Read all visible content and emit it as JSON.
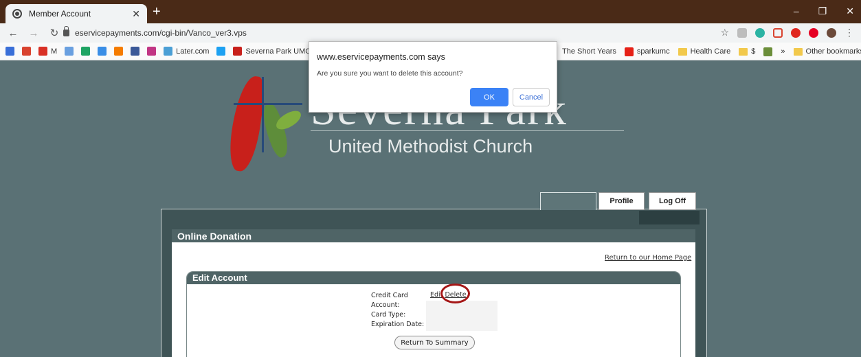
{
  "browser": {
    "tab_title": "Member Account",
    "new_tab": "+",
    "url": "eservicepayments.com/cgi-bin/Vanco_ver3.vps",
    "bookmarks_left": [
      {
        "label": "",
        "icon": "calendar-icon",
        "color": "#3a6fd8"
      },
      {
        "label": "",
        "icon": "todoist-icon",
        "color": "#d9432f"
      },
      {
        "label": "M",
        "icon": "gmail-icon",
        "color": "#d93025"
      },
      {
        "label": "",
        "icon": "ext-icon",
        "color": "#6aa0e0"
      },
      {
        "label": "",
        "icon": "drive-icon",
        "color": "#1fa463"
      },
      {
        "label": "",
        "icon": "diamond-icon",
        "color": "#3a8ee6"
      },
      {
        "label": "",
        "icon": "blogger-icon",
        "color": "#f57c00"
      },
      {
        "label": "",
        "icon": "facebook-icon",
        "color": "#3b5998"
      },
      {
        "label": "",
        "icon": "instagram-icon",
        "color": "#c13584"
      },
      {
        "label": "Later.com",
        "icon": "later-icon",
        "color": "#4b9fd5"
      },
      {
        "label": "",
        "icon": "twitter-icon",
        "color": "#1da1f2"
      },
      {
        "label": "Severna Park UMC",
        "icon": "umc-icon",
        "color": "#c8201b"
      }
    ],
    "bookmarks_right": [
      {
        "label": "The Short Years",
        "icon": "none"
      },
      {
        "label": "sparkumc",
        "icon": "youtube-icon",
        "color": "#e62117"
      },
      {
        "label": "Health Care",
        "icon": "folder-icon",
        "color": "#f2c94c"
      },
      {
        "label": "$",
        "icon": "folder-icon",
        "color": "#f2c94c"
      },
      {
        "label": "",
        "icon": "sheet-icon",
        "color": "#6b8e3a"
      },
      {
        "label": "»",
        "icon": "none"
      },
      {
        "label": "Other bookmarks",
        "icon": "folder-icon",
        "color": "#f2c94c"
      }
    ]
  },
  "logo": {
    "title": "Severna Park",
    "subtitle": "United Methodist Church"
  },
  "nav": {
    "profile": "Profile",
    "logoff": "Log Off"
  },
  "donation": {
    "header": "Online Donation",
    "home_link": "Return to our Home Page",
    "edit_header": "Edit Account",
    "fields": [
      "Credit Card",
      "Account:",
      "Card Type:",
      "Expiration Date:"
    ],
    "edit_link": "Edit",
    "delete_link": "Delete",
    "return_button": "Return To Summary"
  },
  "dialog": {
    "title": "www.eservicepayments.com says",
    "message": "Are you sure you want to delete this account?",
    "ok": "OK",
    "cancel": "Cancel"
  }
}
